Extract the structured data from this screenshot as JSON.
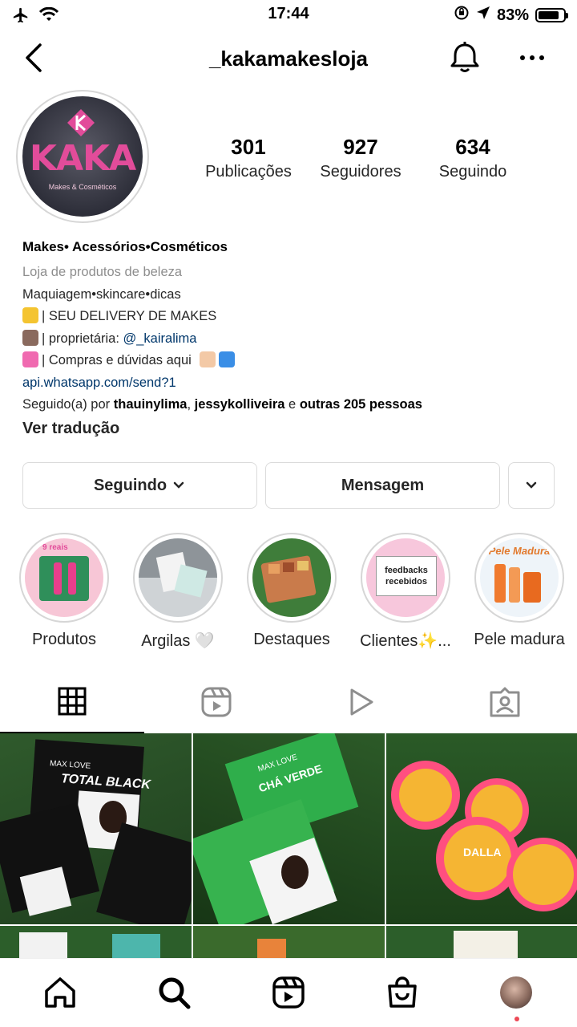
{
  "status_bar": {
    "time": "17:44",
    "battery": "83%",
    "battery_level": 0.83
  },
  "header": {
    "username": "_kakamakesloja"
  },
  "profile": {
    "logo_text": "KAKA",
    "logo_sub": "Makes & Cosméticos",
    "stats": [
      {
        "value": "301",
        "label": "Publicações"
      },
      {
        "value": "927",
        "label": "Seguidores"
      },
      {
        "value": "634",
        "label": "Seguindo"
      }
    ]
  },
  "bio": {
    "name": "Makes• Acessórios•Cosméticos",
    "category": "Loja de produtos de beleza",
    "line1": "Maquiagem•skincare•dicas",
    "line2": "| SEU DELIVERY DE MAKES",
    "line3_prefix": "| proprietária: ",
    "mention": "@_kairalima",
    "line4": "| Compras e dúvidas aqui",
    "link": "api.whatsapp.com/send?1",
    "followed_prefix": "Seguido(a) por ",
    "followed_user1": "thauinylima",
    "followed_sep": ", ",
    "followed_user2": "jessykolliveira",
    "followed_and": " e ",
    "followed_others": "outras 205 pessoas",
    "translate": "Ver tradução"
  },
  "actions": {
    "following": "Seguindo",
    "message": "Mensagem"
  },
  "highlights": [
    {
      "label": "Produtos",
      "tag": "9 reais"
    },
    {
      "label": "Argilas 🤍"
    },
    {
      "label": "Destaques"
    },
    {
      "label": "Clientes✨...",
      "card": "feedbacks recebidos"
    },
    {
      "label": "Pele madura",
      "banner": "Pele Madura"
    }
  ],
  "posts": [
    {
      "brand": "MAX LOVE",
      "product": "TOTAL BLACK"
    },
    {
      "brand": "MAX LOVE",
      "product": "CHÁ VERDE"
    },
    {
      "brand": "DALLA",
      "product": ""
    }
  ],
  "icons": {
    "tabs": [
      "grid-icon",
      "reels-icon",
      "play-icon",
      "tagged-icon"
    ],
    "bottom": [
      "home-icon",
      "search-icon",
      "reels-icon",
      "shop-icon",
      "profile-avatar"
    ]
  },
  "colors": {
    "link": "#00376b",
    "muted": "#8e8e8e",
    "logo_pink": "#e24c9a",
    "notification_dot": "#ed4956"
  }
}
